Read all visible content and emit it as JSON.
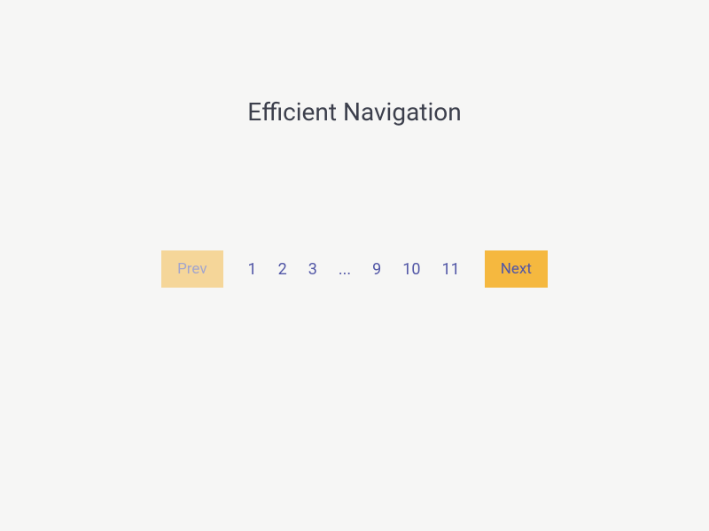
{
  "title": "Efficient Navigation",
  "pagination": {
    "prev_label": "Prev",
    "next_label": "Next",
    "pages": [
      "1",
      "2",
      "3",
      "...",
      "9",
      "10",
      "11"
    ]
  }
}
